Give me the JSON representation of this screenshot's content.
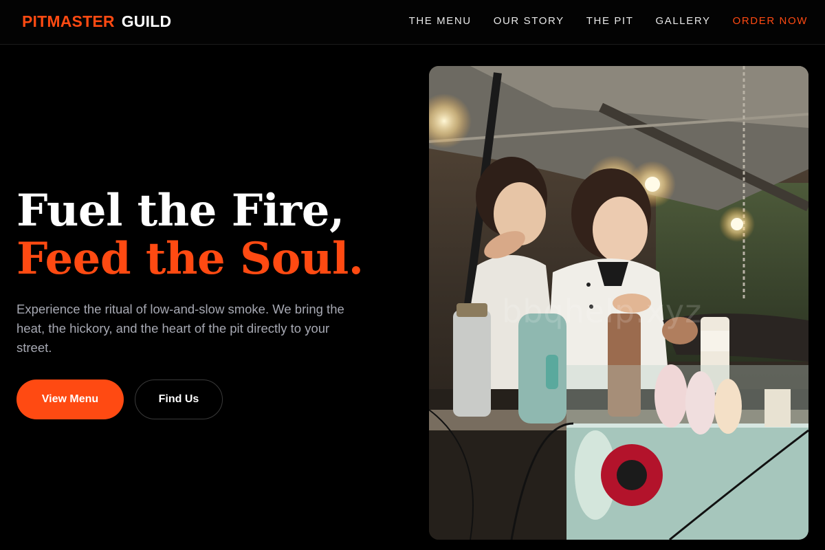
{
  "brand": {
    "part1": "PITMASTER",
    "part2": "GUILD"
  },
  "nav": [
    {
      "label": "THE MENU"
    },
    {
      "label": "OUR STORY"
    },
    {
      "label": "THE PIT"
    },
    {
      "label": "GALLERY"
    },
    {
      "label": "ORDER NOW"
    }
  ],
  "hero": {
    "headline_line1": "Fuel the Fire,",
    "headline_line2": "Feed the Soul.",
    "description": "Experience the ritual of low-and-slow smoke. We bring the heat, the hickory, and the heart of the pit directly to your street.",
    "primary_button": "View Menu",
    "secondary_button": "Find Us"
  },
  "photo": {
    "watermark": "bbqhelp.xyz"
  },
  "colors": {
    "accent": "#ff4a12",
    "background": "#000000",
    "muted_text": "#a7a9b3"
  }
}
